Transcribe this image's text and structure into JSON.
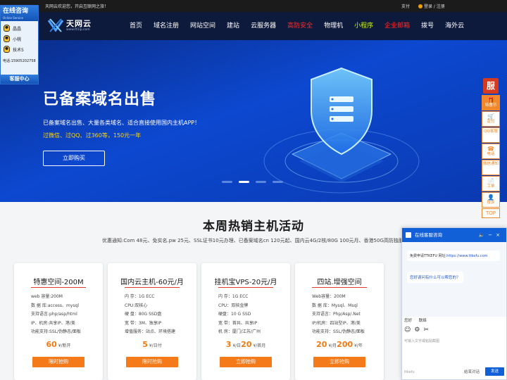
{
  "topbar": {
    "welcome": "天网云欢迎您，开启互联网之旅！",
    "pay": "支付",
    "login": "登录 / 注册"
  },
  "logo": {
    "name": "天网云",
    "url": "www.tt1ip.com"
  },
  "nav": [
    {
      "label": "首页",
      "color": "#ffffff"
    },
    {
      "label": "域名注册",
      "color": "#ffffff"
    },
    {
      "label": "网站空间",
      "color": "#ffffff"
    },
    {
      "label": "建站",
      "color": "#ffffff"
    },
    {
      "label": "云服务器",
      "color": "#ffffff"
    },
    {
      "label": "高防安全",
      "color": "#ff2c2c"
    },
    {
      "label": "物理机",
      "color": "#ffffff"
    },
    {
      "label": "小程序",
      "color": "#c7ef1c"
    },
    {
      "label": "企业邮箱",
      "color": "#ff2c2c"
    },
    {
      "label": "拨号",
      "color": "#ffffff"
    },
    {
      "label": "海外云",
      "color": "#ffffff"
    }
  ],
  "banner": {
    "title": "已备案域名出售",
    "desc": "已备案域名出售、大量各类域名、适合直接使用国内主机APP！",
    "promo": "过微信、过QQ、过360等，150元一年",
    "button": "立即购买",
    "slides": 4,
    "active_slide": 2
  },
  "left_chat": {
    "title": "在线咨询",
    "subtitle": "Online Service",
    "agents": [
      "晶晶",
      "小桃",
      "技术5"
    ],
    "phone": "电话:15905202758",
    "footer": "客服中心"
  },
  "right_side": {
    "logo": "服",
    "buttons": [
      {
        "icon": "gift-icon",
        "glyph": "🎁",
        "label": "特惠节",
        "active": true
      },
      {
        "icon": "cart-icon",
        "glyph": "🛒",
        "label": "定付",
        "active": false
      },
      {
        "icon": "qq-icon",
        "glyph": "",
        "label": "QQ客服",
        "active": false
      },
      {
        "icon": "phone-icon",
        "glyph": "☎",
        "label": "电话",
        "active": false
      },
      {
        "icon": "wechat-icon",
        "glyph": "",
        "label": "微信通知",
        "active": false
      },
      {
        "icon": "ticket-icon",
        "glyph": "📄",
        "label": "工单",
        "active": false
      },
      {
        "icon": "complaint-icon",
        "glyph": "👤",
        "label": "投诉",
        "active": false
      }
    ],
    "top": "TOP"
  },
  "section": {
    "title": "本周热销主机活动",
    "subtitle": "优惠通知:Com 48元、免实名.pw 25元、SSL证书10元办理、已备案域名cn 120元起、国内云4G/2核/80G 100元月、香港50G高防独服"
  },
  "cards": [
    {
      "title": "特惠空间-200M",
      "specs": [
        "web 容量:200M",
        "数 据 库:access、mysql",
        "支持语言:php/asp/html",
        "IP、机房:共享IP、港/美",
        "功能支持:SSL/伪静态/面板"
      ],
      "price_parts": [
        {
          "num": "60",
          "unit": " ¥/新开"
        }
      ],
      "button": "限时抢购"
    },
    {
      "title": "国内云主机-60元/月",
      "specs": [
        "内 存：1G ECC",
        "CPU:双核心",
        "硬 盘：80G SSD盘",
        "宽 带：3M、独享IP",
        "增值服务：站点、环境搭建"
      ],
      "price_parts": [
        {
          "num": "5",
          "unit": " ¥/日付"
        }
      ],
      "button": "限时抢购"
    },
    {
      "title": "挂机宝VPS-20元/月",
      "specs": [
        "内 存：1G ECC",
        "CPU：双核金牌",
        "硬盘：10 G SSD",
        "宽 带：首共、共享IP",
        "机 房：厦门/江苏/广州"
      ],
      "price_parts": [
        {
          "num": "3",
          "unit": " ¥/日"
        },
        {
          "num": "20",
          "unit": " ¥/首月"
        }
      ],
      "button": "立即抢购"
    },
    {
      "title": "四站.增强空间",
      "specs": [
        "Web容量：200M",
        "数 据 库：Mysql、Msql",
        "支持语言：Php/Asp/.Net",
        "IP/机房：四站型IP、港/美",
        "功能支持：SSL/伪静态/面板"
      ],
      "price_parts": [
        {
          "num": "20",
          "unit": " ¥/月"
        },
        {
          "num": "200",
          "unit": " ¥/年"
        }
      ],
      "button": "立即抢购"
    }
  ],
  "chat_window": {
    "title": "在线客服咨询",
    "msg1_prefix": "免费申请TTKEFU 网址:",
    "msg1_link": "https://www.ttkefu.com",
    "msg2": "您好请问有什么可以帮您的？",
    "quick": [
      "您好",
      "联络"
    ],
    "input_placeholder": "可输入文字或粘贴截图",
    "brand": "ttkefu",
    "end": "结束对话",
    "send": "发送"
  }
}
